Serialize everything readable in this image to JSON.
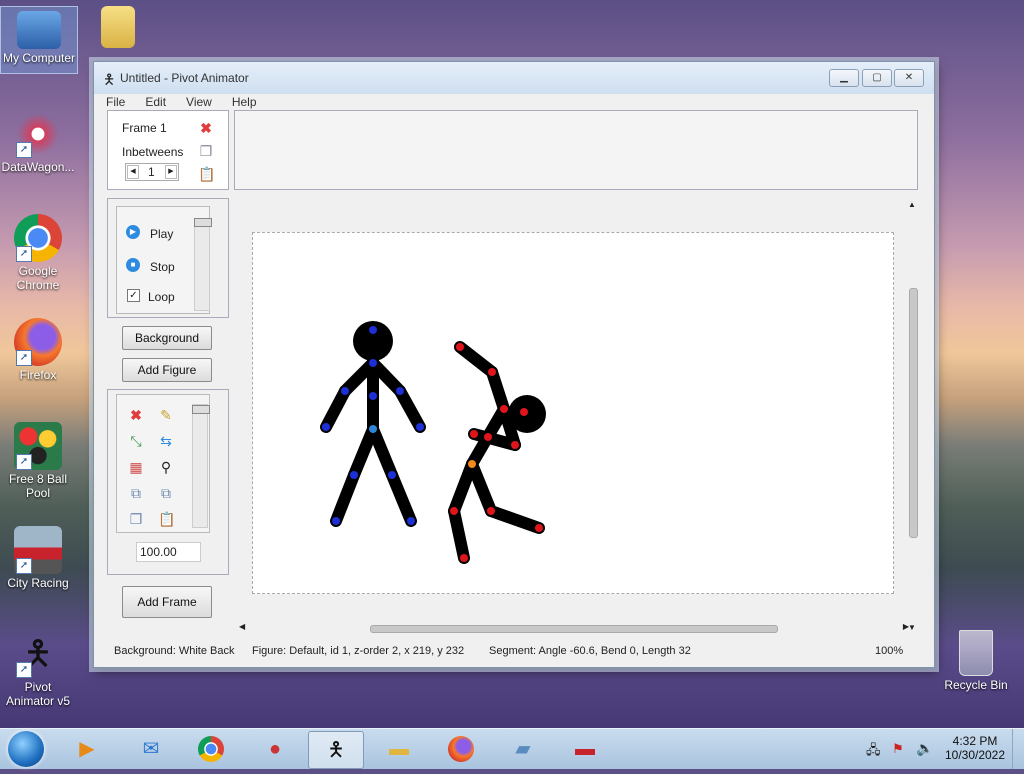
{
  "desktop": {
    "icons": [
      {
        "label": "My Computer"
      },
      {
        "label": "DataWagon..."
      },
      {
        "label": "Google Chrome"
      },
      {
        "label": "Firefox"
      },
      {
        "label": "Free 8 Ball Pool"
      },
      {
        "label": "City Racing"
      },
      {
        "label": "Pivot Animator v5"
      },
      {
        "label": "Recycle Bin"
      }
    ]
  },
  "window": {
    "title": "Untitled - Pivot Animator",
    "menu": [
      "File",
      "Edit",
      "View",
      "Help"
    ]
  },
  "frame_panel": {
    "frame_label": "Frame 1",
    "inbetweens_label": "Inbetweens",
    "inbetweens_value": "1"
  },
  "playback": {
    "play": "Play",
    "stop": "Stop",
    "loop": "Loop",
    "loop_checked": true
  },
  "buttons": {
    "background": "Background",
    "add_figure": "Add Figure",
    "add_frame": "Add Frame"
  },
  "tools": {
    "scale_value": "100.00",
    "icons": [
      "delete-icon",
      "pencil-icon",
      "shrink-icon",
      "flip-icon",
      "color-grid-icon",
      "magic-wand-icon",
      "front-icon",
      "back-icon",
      "copy-icon",
      "paste-icon"
    ]
  },
  "status": {
    "background": "Background: White Back",
    "figure": "Figure: Default,  id 1,  z-order 2,  x 219, y 232",
    "segment": "Segment: Angle -60.6,  Bend 0,  Length 32",
    "zoom": "100%"
  },
  "taskbar": {
    "time": "4:32 PM",
    "date": "10/30/2022"
  },
  "colors": {
    "handle_blue": "#1d2fd6",
    "handle_red": "#e0151b",
    "handle_orange": "#f08a1a"
  }
}
